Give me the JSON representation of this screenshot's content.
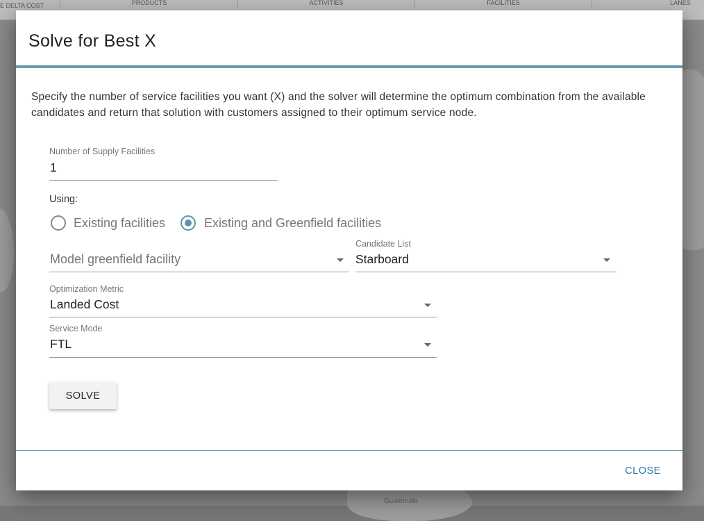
{
  "background": {
    "topbar_items": [
      "E DELTA COST",
      "PRODUCTS",
      "ACTIVITIES",
      "FACILITIES",
      "LANES"
    ],
    "map_label": "Guatemala"
  },
  "dialog": {
    "title": "Solve for Best X",
    "description": "Specify the number of service facilities you want (X) and the solver will determine the optimum combination from the available candidates and return that solution with customers assigned to their optimum service node.",
    "supply_facilities": {
      "label": "Number of Supply Facilities",
      "value": "1"
    },
    "using": {
      "label": "Using:",
      "options": [
        {
          "label": "Existing facilities",
          "checked": false
        },
        {
          "label": "Existing and Greenfield facilities",
          "checked": true
        }
      ]
    },
    "model_greenfield": {
      "placeholder": "Model greenfield facility"
    },
    "candidate_list": {
      "label": "Candidate List",
      "value": "Starboard"
    },
    "optimization_metric": {
      "label": "Optimization Metric",
      "value": "Landed Cost"
    },
    "service_mode": {
      "label": "Service Mode",
      "value": "FTL"
    },
    "solve_label": "SOLVE",
    "close_label": "CLOSE"
  },
  "colors": {
    "accent": "#6c9cad",
    "radio": "#5d93a8",
    "link": "#2a76a8"
  }
}
